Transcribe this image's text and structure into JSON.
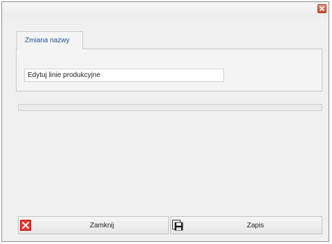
{
  "window": {
    "close_label": "close"
  },
  "tabs": [
    {
      "label": "Zmiana nazwy"
    }
  ],
  "form": {
    "name_value": "Edytuj linie produkcyjne",
    "name_placeholder": ""
  },
  "buttons": {
    "close_label": "Zamknij",
    "close_icon": "close-icon",
    "save_label": "Zapis",
    "save_icon": "floppy-disk-icon"
  },
  "colors": {
    "tab_label": "#1e4e9a",
    "close_icon": "#e8352b",
    "title_close": "#c8462a"
  }
}
